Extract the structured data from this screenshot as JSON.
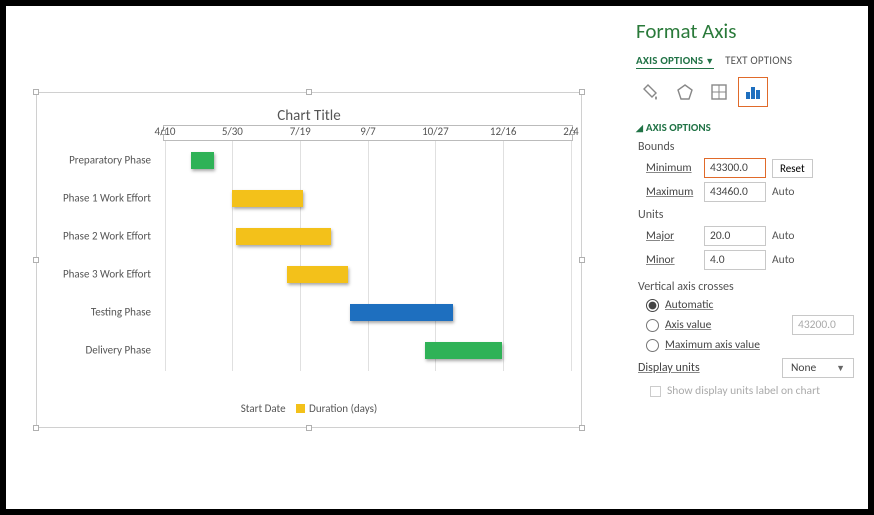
{
  "chart_data": {
    "type": "bar",
    "orientation": "horizontal_gantt",
    "title": "Chart Title",
    "x_ticks": [
      "4/10",
      "5/30",
      "7/19",
      "9/7",
      "10/27",
      "12/16",
      "2/4"
    ],
    "x_range_serial": [
      43300.0,
      43500.0
    ],
    "categories": [
      "Preparatory Phase",
      "Phase 1 Work Effort",
      "Phase 2 Work Effort",
      "Phase 3 Work Effort",
      "Testing Phase",
      "Delivery Phase"
    ],
    "series": [
      {
        "name": "Start Date",
        "visible_bar": false
      },
      {
        "name": "Duration (days)",
        "visible_bar": true
      }
    ],
    "tasks": [
      {
        "name": "Preparatory Phase",
        "start_pct": 0.065,
        "width_pct": 0.055,
        "color": "green"
      },
      {
        "name": "Phase 1 Work Effort",
        "start_pct": 0.165,
        "width_pct": 0.175,
        "color": "yellow"
      },
      {
        "name": "Phase 2 Work Effort",
        "start_pct": 0.175,
        "width_pct": 0.235,
        "color": "yellow"
      },
      {
        "name": "Phase 3 Work Effort",
        "start_pct": 0.3,
        "width_pct": 0.15,
        "color": "yellow"
      },
      {
        "name": "Testing Phase",
        "start_pct": 0.455,
        "width_pct": 0.255,
        "color": "blue"
      },
      {
        "name": "Delivery Phase",
        "start_pct": 0.64,
        "width_pct": 0.19,
        "color": "green"
      }
    ],
    "legend": [
      "Start Date",
      "Duration (days)"
    ]
  },
  "legend": {
    "start": "Start Date",
    "duration": "Duration (days)"
  },
  "pane": {
    "title": "Format Axis",
    "tabs": {
      "axis": "AXIS OPTIONS",
      "text": "TEXT OPTIONS"
    },
    "section": "AXIS OPTIONS",
    "bounds_label": "Bounds",
    "min_label": "Minimum",
    "min_value": "43300.0",
    "min_action": "Reset",
    "max_label": "Maximum",
    "max_value": "43460.0",
    "max_action": "Auto",
    "units_label": "Units",
    "major_label": "Major",
    "major_value": "20.0",
    "major_action": "Auto",
    "minor_label": "Minor",
    "minor_value": "4.0",
    "minor_action": "Auto",
    "vac_label": "Vertical axis crosses",
    "vac_auto": "Automatic",
    "vac_value_label": "Axis value",
    "vac_value": "43200.0",
    "vac_max": "Maximum axis value",
    "display_units_label": "Display units",
    "display_units_value": "None",
    "show_chk": "Show display units label on chart"
  }
}
